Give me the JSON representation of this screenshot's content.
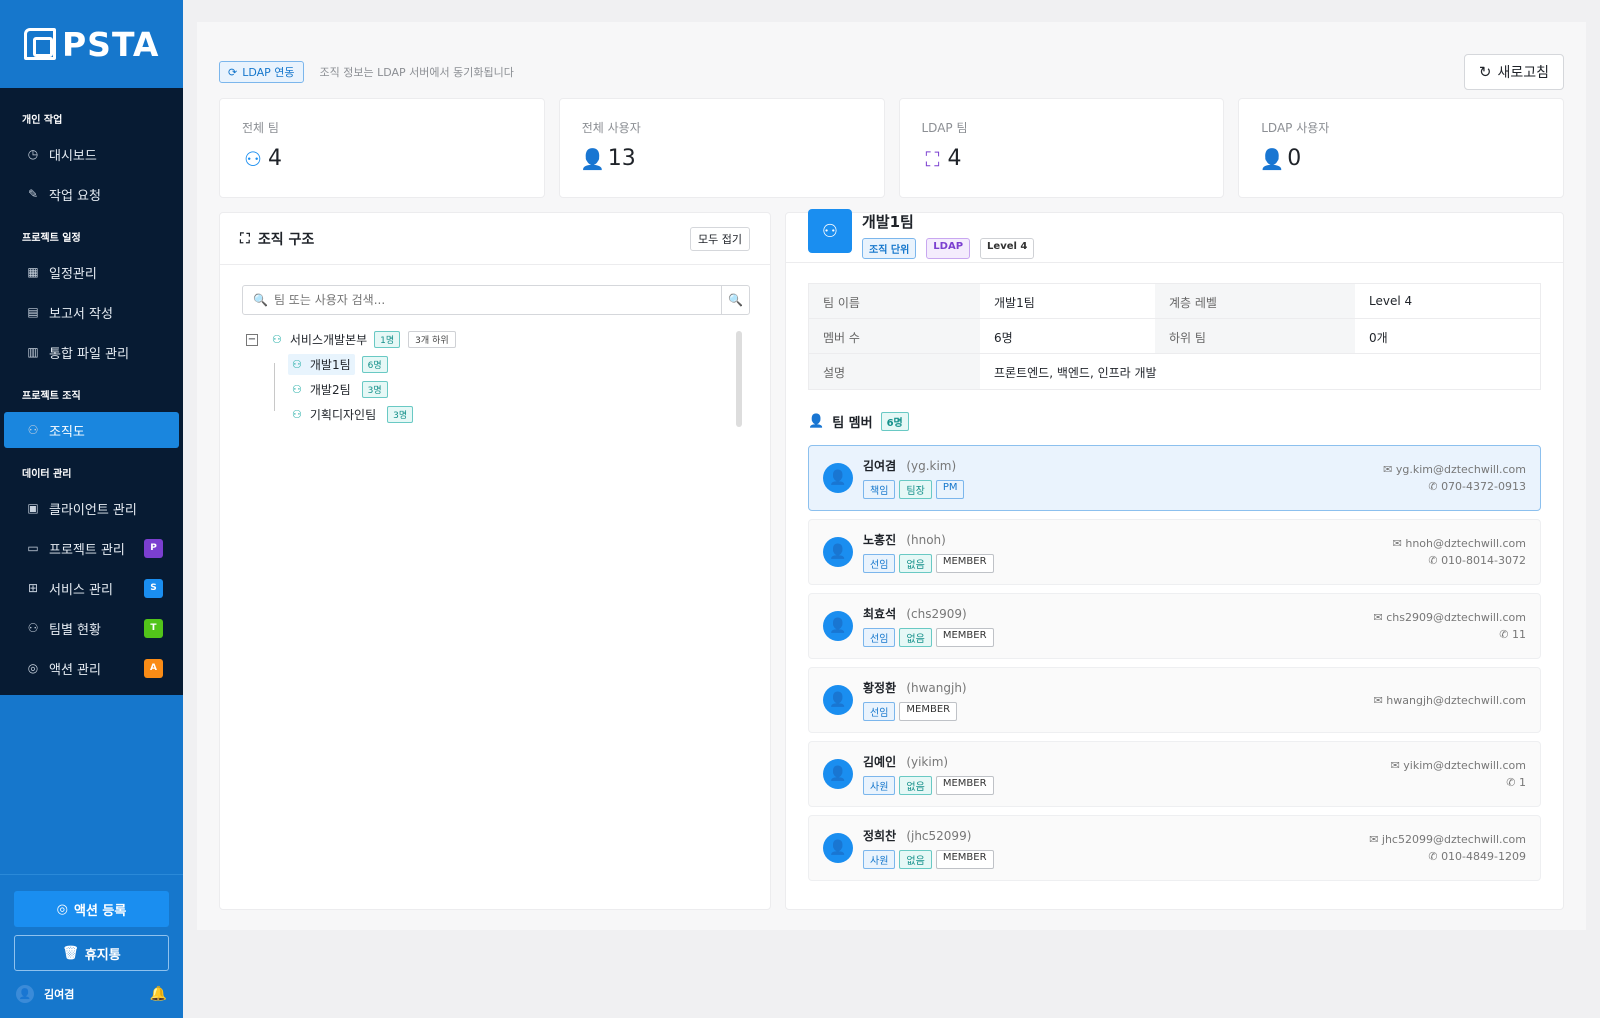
{
  "brand": {
    "name": "PSTA"
  },
  "sidebar": {
    "sections": [
      {
        "title": "개인 작업",
        "items": [
          {
            "label": "대시보드",
            "icon": "dashboard-icon"
          },
          {
            "label": "작업 요청",
            "icon": "edit-icon"
          }
        ]
      },
      {
        "title": "프로젝트 일정",
        "items": [
          {
            "label": "일정관리",
            "icon": "calendar-icon"
          },
          {
            "label": "보고서 작성",
            "icon": "document-icon"
          },
          {
            "label": "통합 파일 관리",
            "icon": "file-icon"
          }
        ]
      },
      {
        "title": "프로젝트 조직",
        "items": [
          {
            "label": "조직도",
            "icon": "org-chart-icon",
            "active": true
          }
        ]
      },
      {
        "title": "데이터 관리",
        "items": [
          {
            "label": "클라이언트 관리",
            "icon": "building-icon"
          },
          {
            "label": "프로젝트 관리",
            "icon": "folder-icon",
            "badge": "P",
            "badge_color": "#7b3fd0"
          },
          {
            "label": "서비스 관리",
            "icon": "grid-icon",
            "badge": "S",
            "badge_color": "#1a8ef0"
          },
          {
            "label": "팀별 현황",
            "icon": "team-icon",
            "badge": "T",
            "badge_color": "#52c41a"
          },
          {
            "label": "액션 관리",
            "icon": "check-circle-icon",
            "badge": "A",
            "badge_color": "#fa8c16"
          }
        ]
      }
    ],
    "register_action": "액션 등록",
    "trash": "휴지통",
    "user_name": "김여겸"
  },
  "topbar": {
    "ldap_tag": "LDAP 연동",
    "note": "조직 정보는 LDAP 서버에서 동기화됩니다",
    "refresh": "새로고침"
  },
  "stats": [
    {
      "label": "전체 팀",
      "value": "4",
      "icon": "team-icon",
      "color": "#1a8ef0"
    },
    {
      "label": "전체 사용자",
      "value": "13",
      "icon": "user-icon",
      "color": "#52c41a"
    },
    {
      "label": "LDAP 팀",
      "value": "4",
      "icon": "hierarchy-icon",
      "color": "#7b3fd0"
    },
    {
      "label": "LDAP 사용자",
      "value": "0",
      "icon": "user-icon",
      "color": "#fa8c16"
    }
  ],
  "org": {
    "title": "조직 구조",
    "collapse_all": "모두 접기",
    "search_placeholder": "팀 또는 사용자 검색...",
    "root": {
      "name": "서비스개발본부",
      "count": "1명",
      "sub": "3개 하위"
    },
    "children": [
      {
        "name": "개발1팀",
        "count": "6명"
      },
      {
        "name": "개발2팀",
        "count": "3명"
      },
      {
        "name": "기획디자인팀",
        "count": "3명"
      }
    ]
  },
  "detail": {
    "team_name": "개발1팀",
    "tags": [
      "조직 단위",
      "LDAP",
      "Level 4"
    ],
    "info": {
      "team_name_label": "팀 이름",
      "team_name_value": "개발1팀",
      "level_label": "계층 레벨",
      "level_value": "Level 4",
      "members_label": "멤버 수",
      "members_value": "6명",
      "subteam_label": "하위 팀",
      "subteam_value": "0개",
      "desc_label": "설명",
      "desc_value": "프론트엔드, 백엔드, 인프라 개발"
    },
    "members_title": "팀 멤버",
    "members_count": "6명",
    "members": [
      {
        "name": "김여겸",
        "id": "(yg.kim)",
        "tags": [
          [
            "책임",
            "blue"
          ],
          [
            "팀장",
            "teal"
          ],
          [
            "PM",
            "blue"
          ]
        ],
        "email": "yg.kim@dztechwill.com",
        "phone": "070-4372-0913"
      },
      {
        "name": "노홍진",
        "id": "(hnoh)",
        "tags": [
          [
            "선임",
            "blue"
          ],
          [
            "없음",
            "teal"
          ],
          [
            "MEMBER",
            "plain"
          ]
        ],
        "email": "hnoh@dztechwill.com",
        "phone": "010-8014-3072"
      },
      {
        "name": "최효석",
        "id": "(chs2909)",
        "tags": [
          [
            "선임",
            "blue"
          ],
          [
            "없음",
            "teal"
          ],
          [
            "MEMBER",
            "plain"
          ]
        ],
        "email": "chs2909@dztechwill.com",
        "phone": "11"
      },
      {
        "name": "황정환",
        "id": "(hwangjh)",
        "tags": [
          [
            "선임",
            "blue"
          ],
          [
            "MEMBER",
            "plain"
          ]
        ],
        "email": "hwangjh@dztechwill.com",
        "phone": ""
      },
      {
        "name": "김예인",
        "id": "(yikim)",
        "tags": [
          [
            "사원",
            "blue"
          ],
          [
            "없음",
            "teal"
          ],
          [
            "MEMBER",
            "plain"
          ]
        ],
        "email": "yikim@dztechwill.com",
        "phone": "1"
      },
      {
        "name": "정희찬",
        "id": "(jhc52099)",
        "tags": [
          [
            "사원",
            "blue"
          ],
          [
            "없음",
            "teal"
          ],
          [
            "MEMBER",
            "plain"
          ]
        ],
        "email": "jhc52099@dztechwill.com",
        "phone": "010-4849-1209"
      }
    ]
  }
}
